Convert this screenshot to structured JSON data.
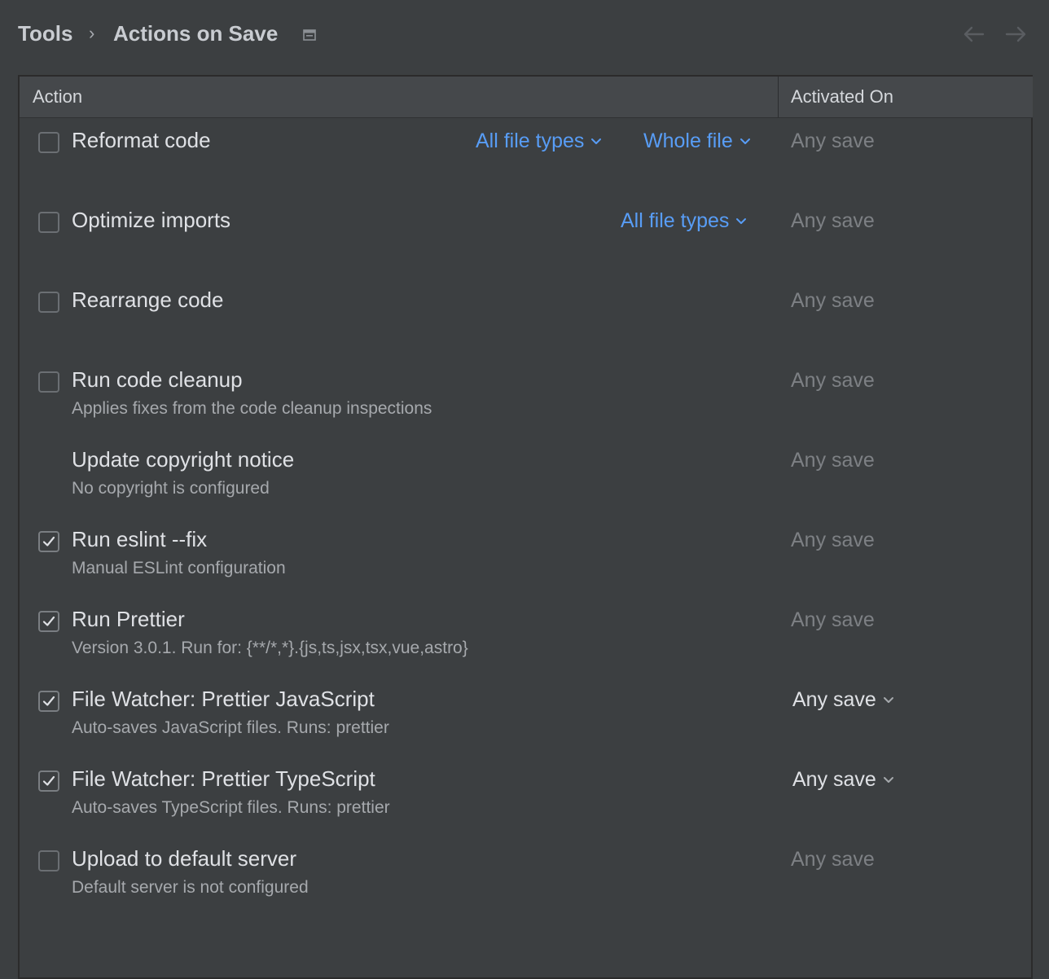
{
  "breadcrumb": {
    "root": "Tools",
    "separator": "›",
    "current": "Actions on Save"
  },
  "table": {
    "headers": {
      "action": "Action",
      "activated_on": "Activated On"
    },
    "rows": [
      {
        "title": "Reformat code",
        "subtitle": "",
        "checked": false,
        "has_checkbox": true,
        "file_types": "All file types",
        "scope": "Whole file",
        "activated": "Any save",
        "activated_dropdown": false
      },
      {
        "title": "Optimize imports",
        "subtitle": "",
        "checked": false,
        "has_checkbox": true,
        "file_types": "All file types",
        "activated": "Any save",
        "activated_dropdown": false
      },
      {
        "title": "Rearrange code",
        "subtitle": "",
        "checked": false,
        "has_checkbox": true,
        "activated": "Any save",
        "activated_dropdown": false
      },
      {
        "title": "Run code cleanup",
        "subtitle": "Applies fixes from the code cleanup inspections",
        "checked": false,
        "has_checkbox": true,
        "activated": "Any save",
        "activated_dropdown": false
      },
      {
        "title": "Update copyright notice",
        "subtitle": "No copyright is configured",
        "checked": false,
        "has_checkbox": false,
        "activated": "Any save",
        "activated_dropdown": false
      },
      {
        "title": "Run eslint --fix",
        "subtitle": "Manual ESLint configuration",
        "checked": true,
        "has_checkbox": true,
        "activated": "Any save",
        "activated_dropdown": false
      },
      {
        "title": "Run Prettier",
        "subtitle": "Version 3.0.1. Run for: {**/*,*}.{js,ts,jsx,tsx,vue,astro}",
        "checked": true,
        "has_checkbox": true,
        "activated": "Any save",
        "activated_dropdown": false
      },
      {
        "title": "File Watcher: Prettier JavaScript",
        "subtitle": "Auto-saves JavaScript files. Runs: prettier",
        "checked": true,
        "has_checkbox": true,
        "activated": "Any save",
        "activated_dropdown": true
      },
      {
        "title": "File Watcher: Prettier TypeScript",
        "subtitle": "Auto-saves TypeScript files. Runs: prettier",
        "checked": true,
        "has_checkbox": true,
        "activated": "Any save",
        "activated_dropdown": true
      },
      {
        "title": "Upload to default server",
        "subtitle": "Default server is not configured",
        "checked": false,
        "has_checkbox": true,
        "activated": "Any save",
        "activated_dropdown": false
      }
    ]
  },
  "colors": {
    "background": "#3c3f41",
    "header": "#45484b",
    "link": "#589df6",
    "muted": "#7d8084"
  },
  "icons": {
    "breadcrumb_icon": "window-icon",
    "back": "arrow-left-icon",
    "forward": "arrow-right-icon",
    "dropdown": "chevron-down-icon",
    "check": "checkmark-icon"
  }
}
